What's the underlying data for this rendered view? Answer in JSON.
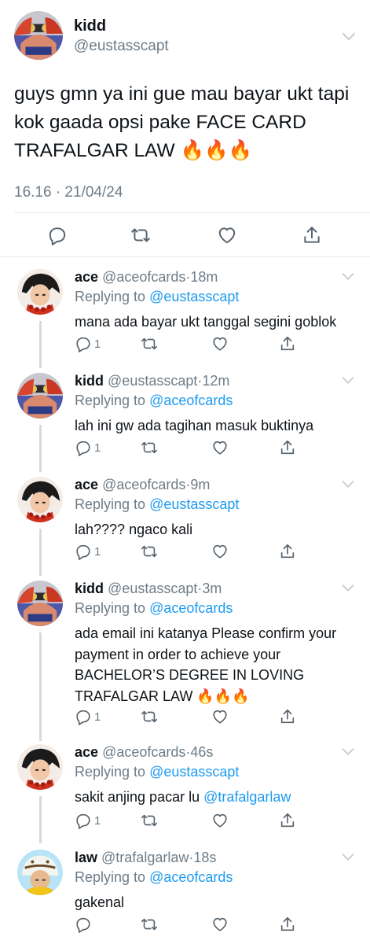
{
  "main_tweet": {
    "display_name": "kidd",
    "handle": "@eustasscapt",
    "text": "guys gmn ya ini gue mau bayar ukt tapi kok gaada opsi pake FACE CARD TRAFALGAR LAW",
    "emoji": "🔥🔥🔥",
    "timestamp": "16.16 · 21/04/24"
  },
  "replies": [
    {
      "display_name": "ace",
      "handle": "@aceofcards",
      "time": "18m",
      "replying_prefix": "Replying to",
      "replying_to": "@eustasscapt",
      "text": "mana ada bayar ukt tanggal segini goblok",
      "reply_count": "1"
    },
    {
      "display_name": "kidd",
      "handle": "@eustasscapt",
      "time": "12m",
      "replying_prefix": "Replying to",
      "replying_to": "@aceofcards",
      "text": "lah ini gw ada tagihan masuk buktinya",
      "reply_count": "1"
    },
    {
      "display_name": "ace",
      "handle": "@aceofcards",
      "time": "9m",
      "replying_prefix": "Replying to",
      "replying_to": "@eustasscapt",
      "text": "lah???? ngaco kali",
      "reply_count": "1"
    },
    {
      "display_name": "kidd",
      "handle": "@eustasscapt",
      "time": "3m",
      "replying_prefix": "Replying to",
      "replying_to": "@aceofcards",
      "text": "ada email ini katanya Please confirm your payment in order to achieve your BACHELOR’S DEGREE IN LOVING TRAFALGAR LAW",
      "emoji": "🔥🔥🔥",
      "reply_count": "1"
    },
    {
      "display_name": "ace",
      "handle": "@aceofcards",
      "time": "46s",
      "replying_prefix": "Replying to",
      "replying_to": "@eustasscapt",
      "text": "sakit anjing pacar lu",
      "mention": "@trafalgarlaw",
      "reply_count": "1"
    },
    {
      "display_name": "law",
      "handle": "@trafalgarlaw",
      "time": "18s",
      "replying_prefix": "Replying to",
      "replying_to": "@aceofcards",
      "text": "gakenal",
      "reply_count": ""
    }
  ],
  "separator": "·",
  "icons": [
    "reply-icon",
    "retweet-icon",
    "like-icon",
    "share-icon",
    "chevron-down-icon"
  ],
  "colors": {
    "link": "#1d9bf0",
    "muted": "#6e7c87",
    "text": "#0f1419"
  }
}
